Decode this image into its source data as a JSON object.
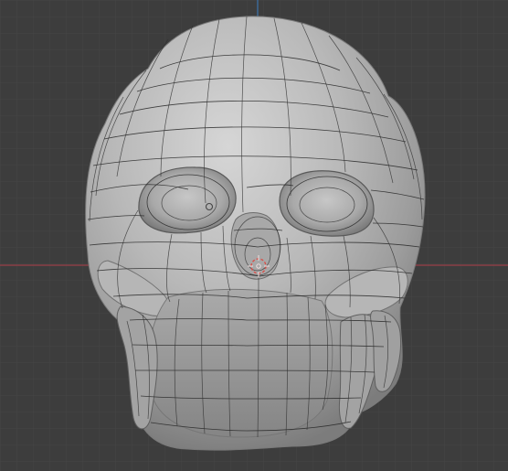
{
  "viewport": {
    "mode": "3d-viewport-wireframe-overlay",
    "background_color": "#3d3d3d",
    "grid_color": "#474747",
    "x_axis_color": "#9a3f48",
    "z_axis_color": "#3c6fa3",
    "mesh_color": "#b8b8b8",
    "wire_color": "#262626",
    "cursor_color": "#d8504a",
    "object_icon": "skull-mesh-icon",
    "cursor_icon": "3d-cursor-icon",
    "origin_icon": "object-origin-icon"
  }
}
